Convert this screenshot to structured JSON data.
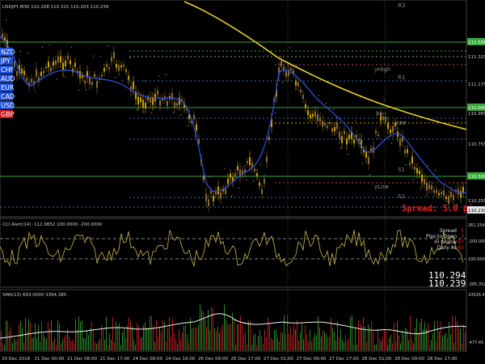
{
  "header": {
    "symbol_info": "USDJPY,M30 110.208 110.315 110.203 110.239"
  },
  "currencies": [
    {
      "code": "NZD",
      "color": "#1f4fd8"
    },
    {
      "code": "JPY",
      "color": "#1f4fd8"
    },
    {
      "code": "CHF",
      "color": "#1f4fd8"
    },
    {
      "code": "AUD",
      "color": "#1f4fd8"
    },
    {
      "code": "EUR",
      "color": "#1f4fd8"
    },
    {
      "code": "CAD",
      "color": "#1f4fd8"
    },
    {
      "code": "USD",
      "color": "#1f4fd8"
    },
    {
      "code": "GBP",
      "color": "#d01818"
    }
  ],
  "pivots": {
    "r3": "R3",
    "high": "yHigh",
    "r1": "R1",
    "pp": "PP",
    "fpp": "FPP",
    "s1": "S1",
    "low": "yLow",
    "s2": "S2"
  },
  "price_axis": {
    "labels": [
      "111.500",
      "111.325",
      "111.175",
      "110.965",
      "110.755",
      "110.500",
      "110.255",
      "110.239"
    ],
    "highlighted": [
      "111.500",
      "111.000",
      "110.500"
    ]
  },
  "spread_label": "Spread: 5.0 pips",
  "cci": {
    "title": "CCI Alert(14) -112.9852 100.0000 -200.0000",
    "axis": [
      "261.2547",
      "100.0000",
      "-200.0000",
      "-385.3523"
    ],
    "info": [
      {
        "label": "Spread",
        "value": "5"
      },
      {
        "label": "Pips to Open",
        "value": "3"
      },
      {
        "label": "Hi to Low",
        "value": "87"
      },
      {
        "label": "Daily Av",
        "value": "85"
      }
    ],
    "price_big_1": "110.294",
    "price_big_2": "110.239"
  },
  "sma": {
    "title": "SMA(13) 693.0000 3394.385",
    "axis": [
      "10026.45",
      "-477.45"
    ]
  },
  "time_axis": [
    "20 Dec 2018",
    "21 Dec 00:00",
    "21 Dec 08:00",
    "21 Dec 17:00",
    "24 Dec 08:00",
    "24 Dec 16:00",
    "26 Dec 09:00",
    "26 Dec 17:00",
    "27 Dec 01:00",
    "27 Dec 09:00",
    "27 Dec 17:00",
    "28 Dec 01:00",
    "28 Dec 09:00",
    "28 Dec 17:00"
  ],
  "colors": {
    "background": "#000000",
    "bull": "#c8a000",
    "bear": "#8a6b3a",
    "ma_blue": "#2c4bd8",
    "ma_yellow": "#e8d21e",
    "level_green": "#3ca83c",
    "spread": "#e02020",
    "cci_line": "#c8b84a"
  }
}
